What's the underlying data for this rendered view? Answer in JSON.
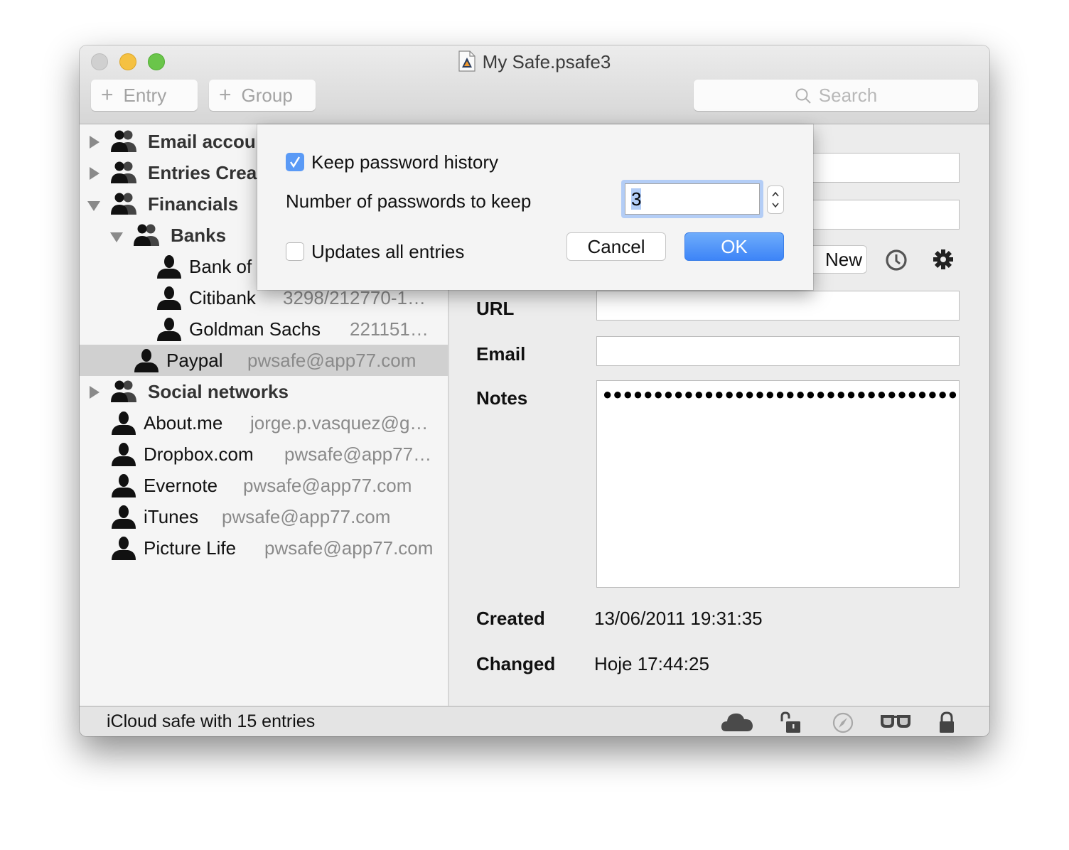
{
  "window": {
    "title": "My Safe.psafe3",
    "doc_icon": "psafe-document-icon"
  },
  "toolbar": {
    "entry_label": "Entry",
    "group_label": "Group",
    "search_placeholder": "Search"
  },
  "sidebar": {
    "items": [
      {
        "type": "group",
        "label": "Email accou",
        "expanded": false,
        "level": 0
      },
      {
        "type": "group",
        "label": "Entries Crea",
        "expanded": false,
        "level": 0
      },
      {
        "type": "group",
        "label": "Financials",
        "expanded": true,
        "level": 0
      },
      {
        "type": "group",
        "label": "Banks",
        "expanded": true,
        "level": 1
      },
      {
        "type": "entry",
        "label": "Bank of",
        "detail": "",
        "level": 2
      },
      {
        "type": "entry",
        "label": "Citibank",
        "detail": "3298/212770-1…",
        "level": 2
      },
      {
        "type": "entry",
        "label": "Goldman Sachs",
        "detail": "221151…",
        "level": 2
      },
      {
        "type": "entry",
        "label": "Paypal",
        "detail": "pwsafe@app77.com",
        "level": 1,
        "selected": true
      },
      {
        "type": "group",
        "label": "Social networks",
        "expanded": false,
        "level": 0
      },
      {
        "type": "entry",
        "label": "About.me",
        "detail": "jorge.p.vasquez@g…",
        "level": 0
      },
      {
        "type": "entry",
        "label": "Dropbox.com",
        "detail": "pwsafe@app77…",
        "level": 0
      },
      {
        "type": "entry",
        "label": "Evernote",
        "detail": "pwsafe@app77.com",
        "level": 0
      },
      {
        "type": "entry",
        "label": "iTunes",
        "detail": "pwsafe@app77.com",
        "level": 0
      },
      {
        "type": "entry",
        "label": "Picture Life",
        "detail": "pwsafe@app77.com",
        "level": 0
      }
    ]
  },
  "detail": {
    "new_button": "New",
    "url_label": "URL",
    "url_value": "",
    "email_label": "Email",
    "email_value": "",
    "notes_label": "Notes",
    "notes_value": "●●●●●●●●●●●●●●●●●●●●●●●●●●●●●●●●●●●●●●",
    "created_label": "Created",
    "created_value": "13/06/2011 19:31:35",
    "changed_label": "Changed",
    "changed_value": "Hoje 17:44:25"
  },
  "dialog": {
    "keep_history_label": "Keep password history",
    "keep_history_checked": true,
    "number_label": "Number of passwords to keep",
    "number_value": "3",
    "update_all_label": "Updates all entries",
    "update_all_checked": false,
    "cancel_label": "Cancel",
    "ok_label": "OK"
  },
  "statusbar": {
    "text": "iCloud safe with 15 entries",
    "icons": [
      "cloud-icon",
      "unlocked-icon",
      "compass-icon",
      "glasses-icon",
      "lock-icon"
    ]
  },
  "colors": {
    "accent": "#3d84f7",
    "checkbox": "#5a9af6",
    "selection": "#d0d0d0"
  }
}
